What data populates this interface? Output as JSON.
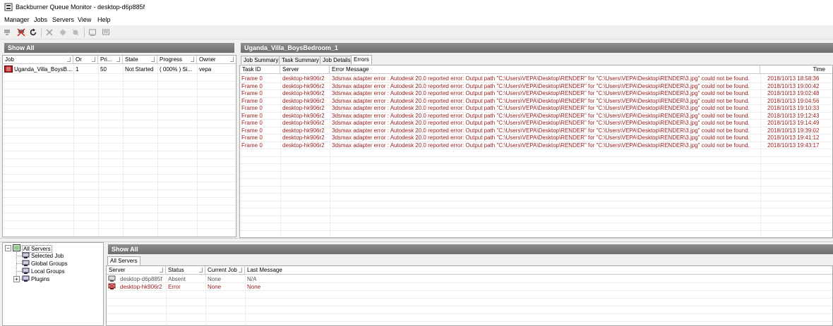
{
  "window": {
    "title": "Backburner Queue Monitor - desktop-d6p885f"
  },
  "menu": [
    "Manager",
    "Jobs",
    "Servers",
    "View",
    "Help"
  ],
  "toolbar": {
    "icons": [
      "connect-icon",
      "disconnect-icon",
      "refresh-icon",
      "delete-icon",
      "activate-icon",
      "deactivate-icon",
      "view-icon",
      "list-icon"
    ]
  },
  "jobs_panel": {
    "header": "Show All",
    "columns": [
      "Job",
      "Or",
      "Pri...",
      "State",
      "Progress",
      "Owner"
    ],
    "rows": [
      {
        "job": "Uganda_Villa_BoysB...",
        "order": "1",
        "priority": "50",
        "state": "Not Started",
        "progress": "( 000% ) Si...",
        "owner": "vepa"
      }
    ]
  },
  "job_detail": {
    "header": "Uganda_Villa_BoysBedroom_1",
    "tabs": [
      "Job Summary",
      "Task Summary",
      "Job Details",
      "Errors"
    ],
    "active_tab": "Errors",
    "columns": [
      "Task ID",
      "Server",
      "Error Message",
      "Time"
    ],
    "error_text": "3dsmax adapter error : Autodesk  20.0 reported error: Output path \"C:\\Users\\VEPA\\Desktop\\RENDER\" for \"C:\\Users\\VEPA\\Desktop\\RENDER\\3.jpg\" could not be found.",
    "rows": [
      {
        "task": "Frame 0",
        "server": "desktop-hk906r2",
        "time": "2018/10/13 18:58:36"
      },
      {
        "task": "Frame 0",
        "server": "desktop-hk906r2",
        "time": "2018/10/13 19:00:42"
      },
      {
        "task": "Frame 0",
        "server": "desktop-hk906r2",
        "time": "2018/10/13 19:02:48"
      },
      {
        "task": "Frame 0",
        "server": "desktop-hk906r2",
        "time": "2018/10/13 19:04:56"
      },
      {
        "task": "Frame 0",
        "server": "desktop-hk906r2",
        "time": "2018/10/13 19:10:33"
      },
      {
        "task": "Frame 0",
        "server": "desktop-hk906r2",
        "time": "2018/10/13 19:12:43"
      },
      {
        "task": "Frame 0",
        "server": "desktop-hk906r2",
        "time": "2018/10/13 19:14:49"
      },
      {
        "task": "Frame 0",
        "server": "desktop-hk906r2",
        "time": "2018/10/13 19:39:02"
      },
      {
        "task": "Frame 0",
        "server": "desktop-hk906r2",
        "time": "2018/10/13 19:41:12"
      },
      {
        "task": "Frame 0",
        "server": "desktop-hk906r2",
        "time": "2018/10/13 19:43:17"
      }
    ]
  },
  "server_tree": {
    "root": "All Servers",
    "children": [
      "Selected Job",
      "Global Groups",
      "Local Groups",
      "Plugins"
    ]
  },
  "servers_panel": {
    "header": "Show All",
    "tab": "All Servers",
    "columns": [
      "Server",
      "Status",
      "Current Job",
      "Last Message"
    ],
    "rows": [
      {
        "server": "desktop-d6p885f",
        "status": "Absent",
        "current_job": "None",
        "last_message": "N/A",
        "kind": "absent"
      },
      {
        "server": "desktop-hk906r2",
        "status": "Error",
        "current_job": "None",
        "last_message": "None",
        "kind": "error"
      }
    ]
  },
  "colors": {
    "error_text": "#9a1d1d",
    "absent_text": "#555555",
    "header_bg": "#7d7d7d"
  }
}
